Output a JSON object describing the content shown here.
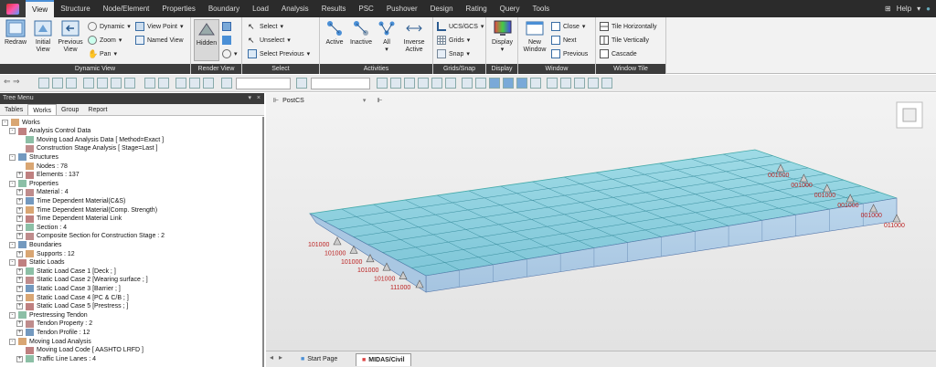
{
  "menu": {
    "items": [
      "View",
      "Structure",
      "Node/Element",
      "Properties",
      "Boundary",
      "Load",
      "Analysis",
      "Results",
      "PSC",
      "Pushover",
      "Design",
      "Rating",
      "Query",
      "Tools"
    ],
    "active": "View",
    "help": "Help"
  },
  "ribbon": {
    "dynamic_view": {
      "title": "Dynamic View",
      "redraw": "Redraw",
      "initial_view": "Initial View",
      "previous_view": "Previous View",
      "dynamic": "Dynamic",
      "zoom": "Zoom",
      "pan": "Pan",
      "view_point": "View Point",
      "named_view": "Named View"
    },
    "render_view": {
      "title": "Render View",
      "hidden": "Hidden"
    },
    "select": {
      "title": "Select",
      "select": "Select",
      "unselect": "Unselect",
      "select_previous": "Select Previous"
    },
    "activities": {
      "title": "Activities",
      "active": "Active",
      "inactive": "Inactive",
      "all": "All",
      "inverse_active": "Inverse Active"
    },
    "grids_snap": {
      "title": "Grids/Snap",
      "ucs": "UCS/GCS",
      "grids": "Grids",
      "snap": "Snap"
    },
    "display": {
      "title": "Display",
      "display": "Display"
    },
    "window": {
      "title": "Window",
      "new_window": "New Window",
      "close": "Close",
      "next": "Next",
      "previous": "Previous"
    },
    "window_tile": {
      "title": "Window Tile",
      "tile_h": "Tile Horizontally",
      "tile_v": "Tile Vertically",
      "cascade": "Cascade"
    }
  },
  "tree": {
    "header": "Tree Menu",
    "tabs": [
      "Tables",
      "Works",
      "Group",
      "Report"
    ],
    "active_tab": "Works",
    "nodes": [
      {
        "label": "Works",
        "level": 0,
        "exp": "-"
      },
      {
        "label": "Analysis Control Data",
        "level": 1,
        "exp": "-"
      },
      {
        "label": "Moving Load Analysis Data [ Method=Exact ]",
        "level": 2,
        "exp": ""
      },
      {
        "label": "Construction Stage Analysis [ Stage=Last ]",
        "level": 2,
        "exp": ""
      },
      {
        "label": "Structures",
        "level": 1,
        "exp": "-"
      },
      {
        "label": "Nodes : 78",
        "level": 2,
        "exp": ""
      },
      {
        "label": "Elements : 137",
        "level": 2,
        "exp": "+"
      },
      {
        "label": "Properties",
        "level": 1,
        "exp": "-"
      },
      {
        "label": "Material : 4",
        "level": 2,
        "exp": "+"
      },
      {
        "label": "Time Dependent Material(C&S)",
        "level": 2,
        "exp": "+"
      },
      {
        "label": "Time Dependent Material(Comp. Strength)",
        "level": 2,
        "exp": "+"
      },
      {
        "label": "Time Dependent Material Link",
        "level": 2,
        "exp": "+"
      },
      {
        "label": "Section : 4",
        "level": 2,
        "exp": "+"
      },
      {
        "label": "Composite Section for Construction Stage : 2",
        "level": 2,
        "exp": "+"
      },
      {
        "label": "Boundaries",
        "level": 1,
        "exp": "-"
      },
      {
        "label": "Supports : 12",
        "level": 2,
        "exp": "+"
      },
      {
        "label": "Static Loads",
        "level": 1,
        "exp": "-"
      },
      {
        "label": "Static Load Case 1 [Deck ; ]",
        "level": 2,
        "exp": "+"
      },
      {
        "label": "Static Load Case 2 [Wearing surface ; ]",
        "level": 2,
        "exp": "+"
      },
      {
        "label": "Static Load Case 3 [Barrier ; ]",
        "level": 2,
        "exp": "+"
      },
      {
        "label": "Static Load Case 4 [PC & C/B ; ]",
        "level": 2,
        "exp": "+"
      },
      {
        "label": "Static Load Case 5 [Prestress ; ]",
        "level": 2,
        "exp": "+"
      },
      {
        "label": "Prestressing Tendon",
        "level": 1,
        "exp": "-"
      },
      {
        "label": "Tendon Property : 2",
        "level": 2,
        "exp": "+"
      },
      {
        "label": "Tendon Profile : 12",
        "level": 2,
        "exp": "+"
      },
      {
        "label": "Moving Load Analysis",
        "level": 1,
        "exp": "-"
      },
      {
        "label": "Moving Load Code [ AASHTO LRFD ]",
        "level": 2,
        "exp": ""
      },
      {
        "label": "Traffic Line Lanes : 4",
        "level": 2,
        "exp": "+"
      }
    ]
  },
  "viewport": {
    "tab_label": "PostCS",
    "support_labels_left": [
      "101000",
      "101000",
      "101000",
      "101000",
      "101000",
      "111000"
    ],
    "support_labels_right": [
      "001000",
      "001000",
      "001000",
      "001000",
      "001000",
      "011000"
    ]
  },
  "bottom_tabs": {
    "start_page": "Start Page",
    "midas": "MIDAS/Civil"
  }
}
